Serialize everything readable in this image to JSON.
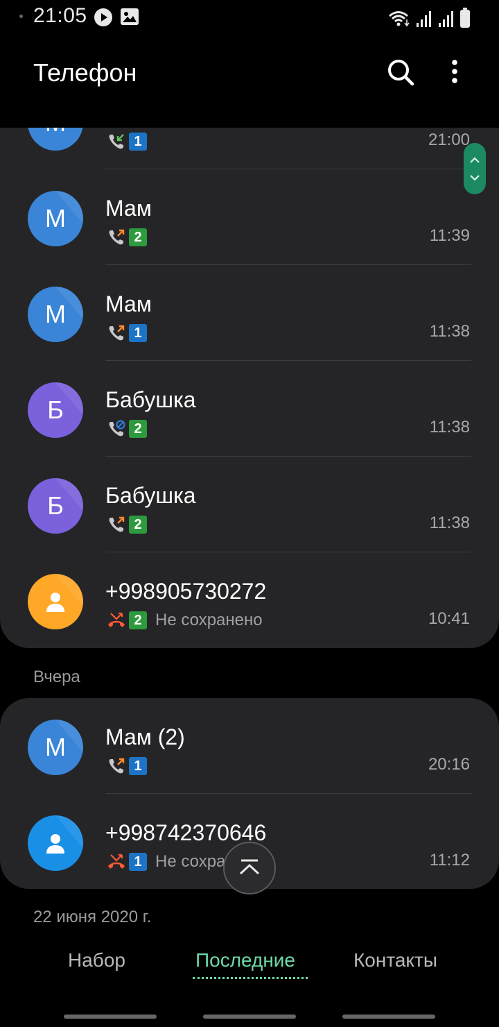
{
  "status_bar": {
    "time": "21:05"
  },
  "app_bar": {
    "title": "Телефон"
  },
  "sections": {
    "today": {
      "partial_row": {
        "time": "21:00",
        "type": "incoming",
        "sim": "1",
        "avatar_color": "#3a85d7",
        "avatar_letter": "М"
      },
      "rows": [
        {
          "name": "Мам",
          "type": "outgoing",
          "sim": "2",
          "time": "11:39",
          "avatar_letter": "М",
          "avatar_color": "#3a85d7"
        },
        {
          "name": "Мам",
          "type": "outgoing",
          "sim": "1",
          "time": "11:38",
          "avatar_letter": "М",
          "avatar_color": "#3a85d7"
        },
        {
          "name": "Бабушка",
          "type": "blocked",
          "sim": "2",
          "time": "11:38",
          "avatar_letter": "Б",
          "avatar_color": "#7b61dc"
        },
        {
          "name": "Бабушка",
          "type": "outgoing",
          "sim": "2",
          "time": "11:38",
          "avatar_letter": "Б",
          "avatar_color": "#7b61dc"
        },
        {
          "name": "+998905730272",
          "type": "missed",
          "sim": "2",
          "sub_label": "Не сохранено",
          "time": "10:41",
          "avatar_color": "#ffa726"
        }
      ]
    },
    "yesterday": {
      "header": "Вчера",
      "rows": [
        {
          "name": "Мам (2)",
          "type": "outgoing",
          "sim": "1",
          "time": "20:16",
          "avatar_letter": "М",
          "avatar_color": "#3a85d7"
        },
        {
          "name": "+998742370646",
          "type": "missed",
          "sim": "1",
          "sub_label": "Не сохра",
          "time": "11:12",
          "avatar_color": "#1a8fe6"
        }
      ]
    },
    "older": {
      "header": "22 июня 2020 г."
    }
  },
  "bottom_nav": {
    "tabs": [
      {
        "label": "Набор"
      },
      {
        "label": "Последние"
      },
      {
        "label": "Контакты"
      }
    ]
  },
  "colors": {
    "accent": "#6ed8a8",
    "card_bg": "#252528",
    "sim1": "#1d74c6",
    "sim2": "#2e9a3e",
    "outgoing_arrow": "#ff8a2b",
    "incoming_arrow": "#5cc35c",
    "missed": "#ff5a36"
  }
}
